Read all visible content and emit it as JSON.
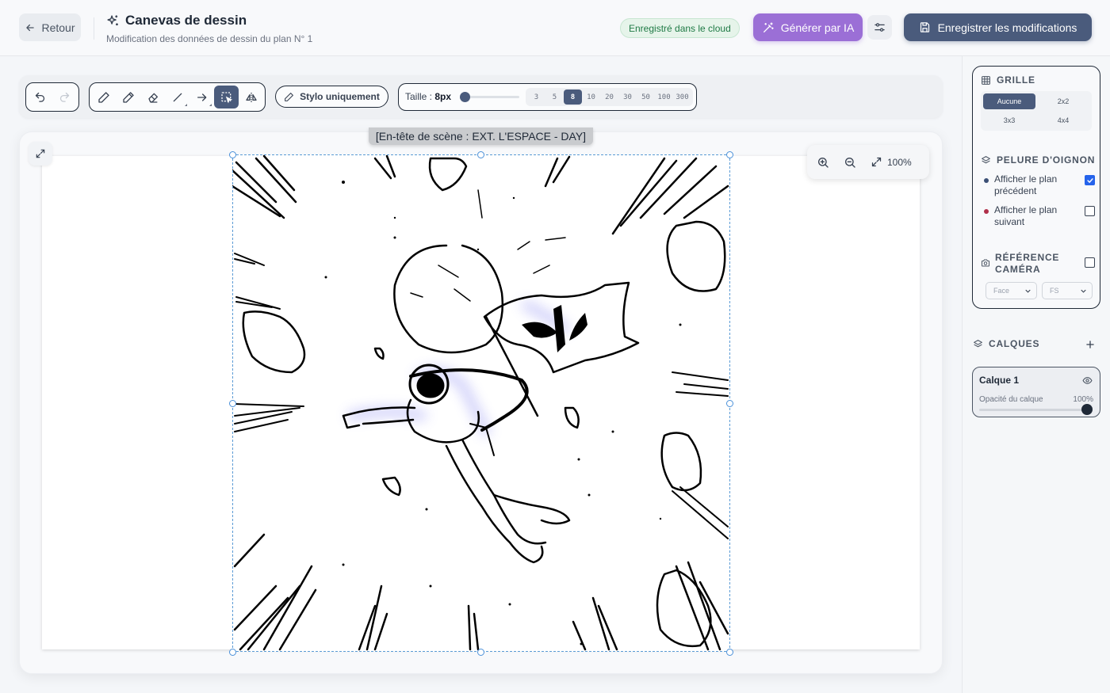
{
  "header": {
    "back_label": "Retour",
    "title": "Canevas de dessin",
    "subtitle": "Modification des données de dessin du plan N° 1",
    "cloud_status": "Enregistré dans le cloud",
    "ai_label": "Générer par IA",
    "save_label": "Enregistrer les modifications"
  },
  "toolbar": {
    "pen_only_label": "Stylo uniquement",
    "size_label": "Taille : ",
    "size_value": "8px",
    "size_slider_fraction": 0.05,
    "presets": [
      "3",
      "5",
      "8",
      "10",
      "20",
      "30",
      "50",
      "100",
      "300"
    ],
    "active_preset": "8"
  },
  "canvas": {
    "scene_heading": "[En-tête de scène : EXT. L'ESPACE - DAY]",
    "zoom": "100%"
  },
  "panel": {
    "grid_title": "GRILLE",
    "grid_options": [
      "Aucune",
      "2x2",
      "3x3",
      "4x4"
    ],
    "grid_active": "Aucune",
    "onion_title": "PELURE D'OIGNON",
    "onion_prev": "Afficher le plan précédent",
    "onion_prev_checked": true,
    "onion_next": "Afficher le plan suivant",
    "onion_next_checked": false,
    "camera_title": "RÉFÉRENCE CAMÉRA",
    "camera_checked": false,
    "camera_angle": "Face",
    "camera_shot": "FS"
  },
  "layers": {
    "title": "CALQUES",
    "items": [
      {
        "name": "Calque 1",
        "opacity_label": "Opacité du calque",
        "opacity": "100%"
      }
    ]
  },
  "colors": {
    "primary": "#4a5b7c",
    "ai_purple": "#9b6fd6",
    "cloud_green": "#1f7a45",
    "onion_prev": "#3b4f75",
    "onion_next": "#b0304a",
    "checkbox_blue": "#2563eb"
  }
}
